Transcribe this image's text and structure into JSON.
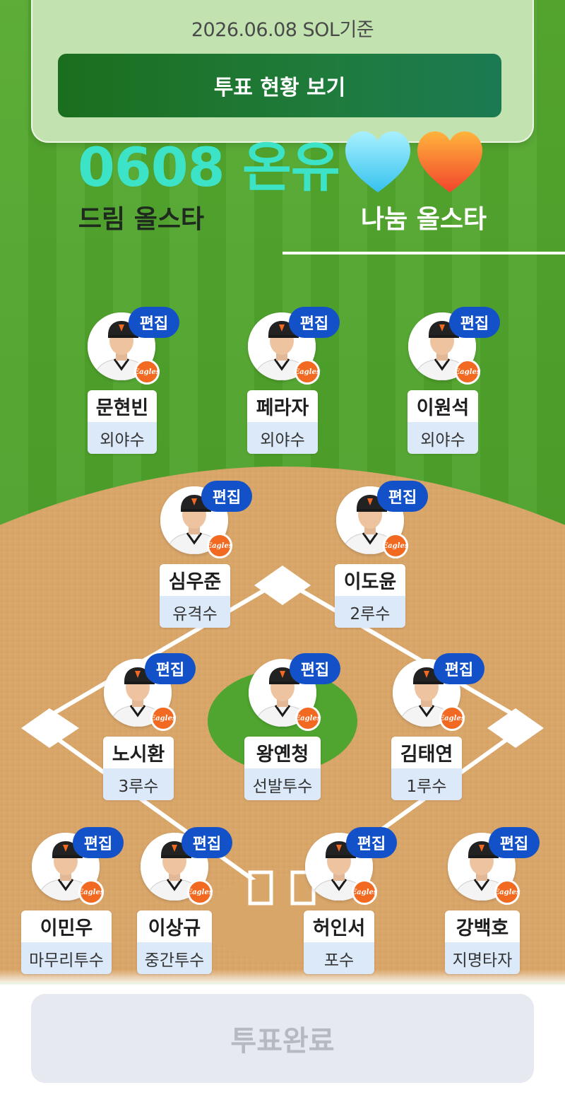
{
  "info": {
    "date_text": "2026.06.08 SOL기준",
    "vote_status_label": "투표 현황 보기"
  },
  "overlay": {
    "text": "0608 온유",
    "hearts": [
      "light-blue-heart-icon",
      "orange-heart-icon"
    ],
    "text_color": "#3de3c6"
  },
  "tabs": {
    "dream": "드림 올스타",
    "share": "나눔 올스타",
    "active": "share"
  },
  "edit_label": "편집",
  "team_badge": "Eagles",
  "players": [
    {
      "name": "문현빈",
      "position": "외야수"
    },
    {
      "name": "페라자",
      "position": "외야수"
    },
    {
      "name": "이원석",
      "position": "외야수"
    },
    {
      "name": "심우준",
      "position": "유격수"
    },
    {
      "name": "이도윤",
      "position": "2루수"
    },
    {
      "name": "노시환",
      "position": "3루수"
    },
    {
      "name": "왕옌청",
      "position": "선발투수"
    },
    {
      "name": "김태연",
      "position": "1루수"
    },
    {
      "name": "이민우",
      "position": "마무리투수"
    },
    {
      "name": "이상규",
      "position": "중간투수"
    },
    {
      "name": "허인서",
      "position": "포수"
    },
    {
      "name": "강백호",
      "position": "지명타자"
    }
  ],
  "vote_complete_label": "투표완료",
  "colors": {
    "grass": "#4fa52f",
    "dirt": "#d9a66a",
    "edit_button": "#1351c9",
    "position_bg": "#dbe9f9",
    "team_badge": "#f26a21"
  }
}
